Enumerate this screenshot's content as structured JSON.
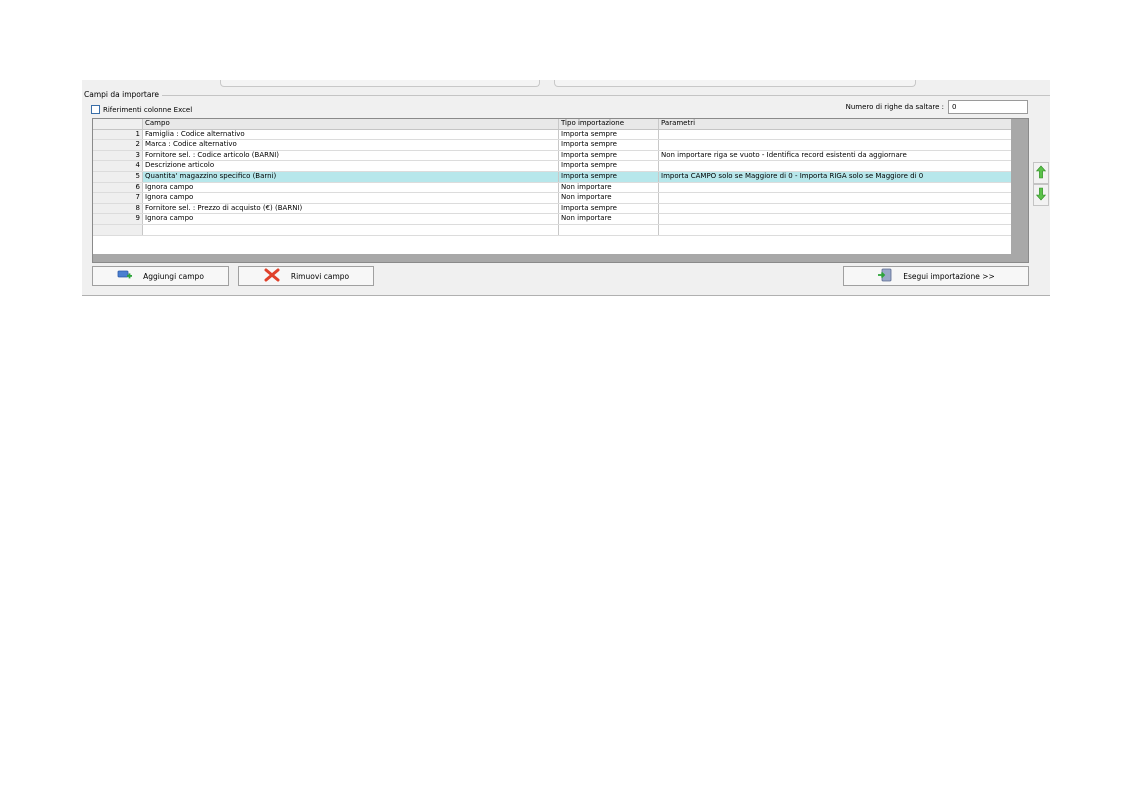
{
  "group": {
    "title": "Campi da importare",
    "checkbox_label": "Riferimenti colonne Excel",
    "checkbox_checked": false
  },
  "rows_to_skip": {
    "label": "Numero di righe da saltare :",
    "value": "0"
  },
  "grid": {
    "headers": [
      "",
      "Campo",
      "Tipo importazione",
      "Parametri"
    ],
    "rows": [
      {
        "num": "1",
        "campo": "Famiglia : Codice alternativo",
        "tipo": "Importa sempre",
        "parametri": ""
      },
      {
        "num": "2",
        "campo": "Marca : Codice alternativo",
        "tipo": "Importa sempre",
        "parametri": ""
      },
      {
        "num": "3",
        "campo": "Fornitore sel. : Codice articolo (BARNI)",
        "tipo": "Importa sempre",
        "parametri": "Non importare riga se vuoto - Identifica record esistenti da aggiornare"
      },
      {
        "num": "4",
        "campo": "Descrizione articolo",
        "tipo": "Importa sempre",
        "parametri": ""
      },
      {
        "num": "5",
        "campo": "Quantita' magazzino specifico (Barni)",
        "tipo": "Importa sempre",
        "parametri": "Importa CAMPO solo se Maggiore di 0 - Importa RIGA solo se Maggiore di 0"
      },
      {
        "num": "6",
        "campo": "Ignora campo",
        "tipo": "Non importare",
        "parametri": ""
      },
      {
        "num": "7",
        "campo": "Ignora campo",
        "tipo": "Non importare",
        "parametri": ""
      },
      {
        "num": "8",
        "campo": "Fornitore sel. : Prezzo di acquisto (€) (BARNI)",
        "tipo": "Importa sempre",
        "parametri": ""
      },
      {
        "num": "9",
        "campo": "Ignora campo",
        "tipo": "Non importare",
        "parametri": ""
      }
    ],
    "selected_row": "5",
    "selection_color": "#b7e7eb"
  },
  "buttons": {
    "add": "Aggiungi campo",
    "remove": "Rimuovi campo",
    "run": "Esegui importazione >>"
  },
  "icons": {
    "add": "add-field-icon",
    "remove": "remove-field-icon",
    "run": "run-import-icon",
    "up": "move-up-arrow-icon",
    "down": "move-down-arrow-icon"
  }
}
